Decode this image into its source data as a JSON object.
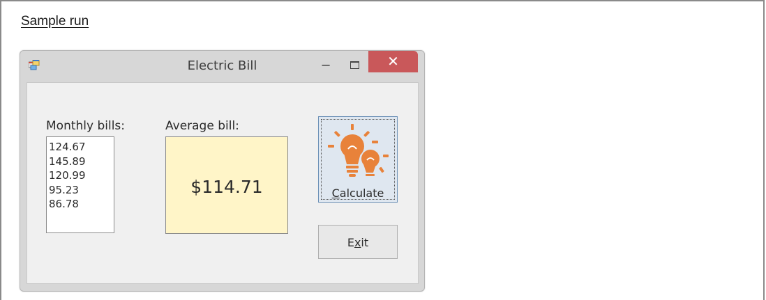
{
  "caption": "Sample run",
  "window": {
    "title": "Electric Bill",
    "icon": "form-icon",
    "controls": {
      "minimize": "–",
      "close": "✕"
    }
  },
  "form": {
    "monthly_label": "Monthly bills:",
    "monthly_bills": [
      "124.67",
      "145.89",
      "120.99",
      "95.23",
      "86.78"
    ],
    "average_label": "Average bill:",
    "average_value": "$114.71",
    "calculate": {
      "first": "C",
      "rest": "alculate",
      "icon": "lightbulb-icon"
    },
    "exit": {
      "first": "E",
      "mnemonic": "x",
      "rest": "it"
    }
  },
  "colors": {
    "close_button": "#c9585a",
    "average_box": "#fff5c8",
    "bulb": "#e8823a"
  }
}
